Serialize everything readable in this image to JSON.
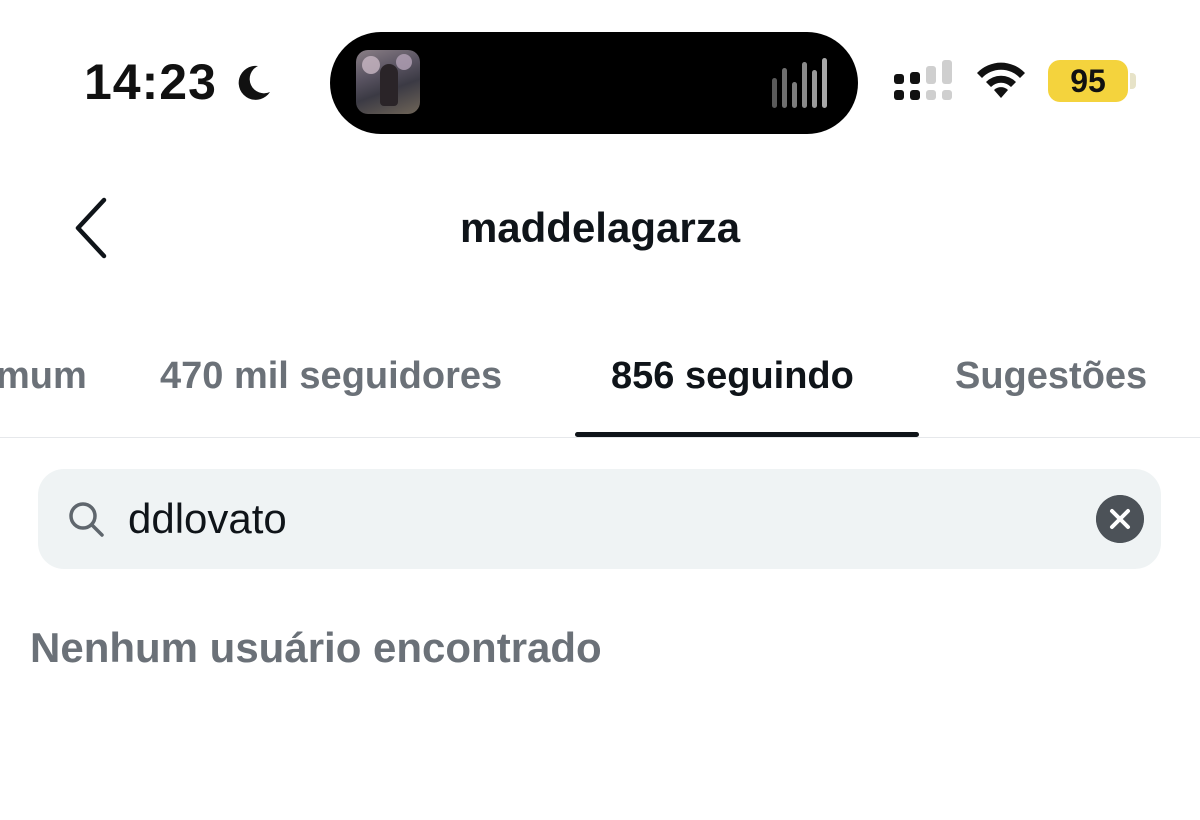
{
  "status_bar": {
    "time": "14:23",
    "battery_level": "95",
    "battery_color": "#f4d33d",
    "icons": [
      "moon-icon",
      "signal-icon",
      "wifi-icon",
      "battery-icon"
    ]
  },
  "header": {
    "title": "maddelagarza",
    "back_icon": "chevron-left-icon"
  },
  "tabs": [
    {
      "label": "mum",
      "active": false
    },
    {
      "label": "470 mil seguidores",
      "active": false
    },
    {
      "label": "856 seguindo",
      "active": true
    },
    {
      "label": "Sugestões",
      "active": false
    }
  ],
  "search": {
    "value": "ddlovato",
    "search_icon": "search-icon",
    "clear_icon": "close-icon"
  },
  "results": {
    "empty_message": "Nenhum usuário encontrado"
  },
  "colors": {
    "text_primary": "#0f1419",
    "text_secondary": "#6b7178",
    "search_bg": "#eff3f4"
  }
}
